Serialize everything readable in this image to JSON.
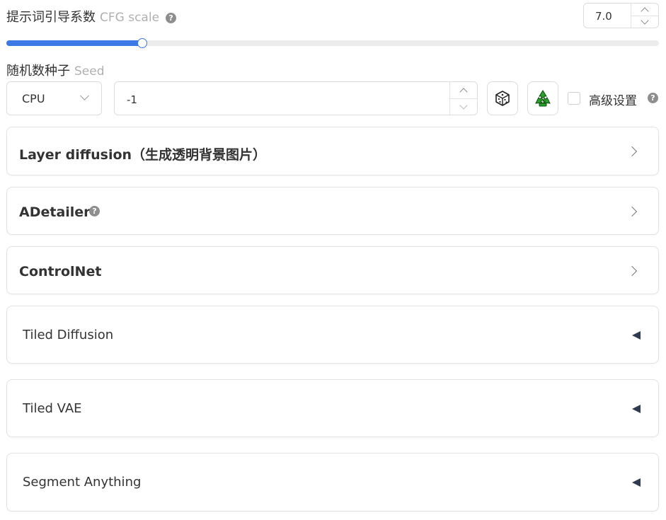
{
  "cfg": {
    "label": "提示词引导系数",
    "label_en": "CFG scale",
    "value": "7.0",
    "slider_fraction": 0.208
  },
  "seed": {
    "label": "随机数种子",
    "label_en": "Seed",
    "device": "CPU",
    "value": "-1",
    "random_icon": "dice-icon",
    "reuse_icon": "recycle-icon",
    "advanced_label": "高级设置",
    "advanced_checked": false
  },
  "panels": [
    {
      "title": "Layer diffusion（生成透明背景图片）",
      "state": "collapsed"
    },
    {
      "title": "ADetailer",
      "state": "collapsed",
      "has_help": true
    },
    {
      "title": "ControlNet",
      "state": "collapsed"
    },
    {
      "title": "Tiled Diffusion",
      "state": "collapsed"
    },
    {
      "title": "Tiled VAE",
      "state": "collapsed"
    },
    {
      "title": "Segment Anything",
      "state": "collapsed"
    }
  ],
  "colors": {
    "accent": "#3c78e6",
    "triangle": "#2f3b52"
  }
}
